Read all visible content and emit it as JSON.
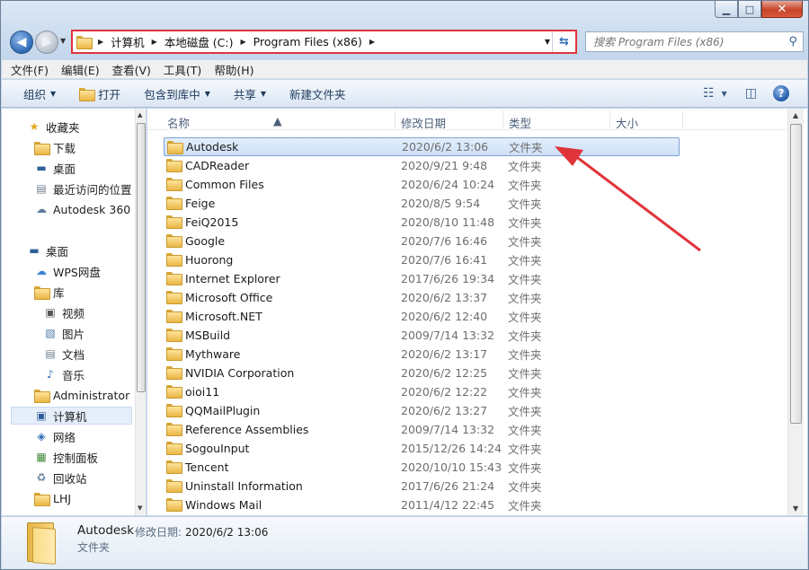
{
  "window": {
    "min_label": "▁",
    "max_label": "□",
    "close_label": "✕"
  },
  "address": {
    "crumbs": [
      "计算机",
      "本地磁盘 (C:)",
      "Program Files (x86)"
    ]
  },
  "search": {
    "placeholder": "搜索 Program Files (x86)"
  },
  "menu": [
    "文件(F)",
    "编辑(E)",
    "查看(V)",
    "工具(T)",
    "帮助(H)"
  ],
  "toolbar": {
    "organize": "组织",
    "open": "打开",
    "include": "包含到库中",
    "share": "共享",
    "new_folder": "新建文件夹"
  },
  "nav": {
    "favorites": "收藏夹",
    "downloads": "下载",
    "desktop_fav": "桌面",
    "recent": "最近访问的位置",
    "autodesk360": "Autodesk 360",
    "desktop": "桌面",
    "wps": "WPS网盘",
    "libraries": "库",
    "videos": "视频",
    "pictures": "图片",
    "documents": "文档",
    "music": "音乐",
    "admin": "Administrator",
    "computer": "计算机",
    "network": "网络",
    "control_panel": "控制面板",
    "recycle": "回收站",
    "lhj": "LHJ"
  },
  "columns": {
    "name": "名称",
    "date": "修改日期",
    "type": "类型",
    "size": "大小"
  },
  "files": [
    {
      "name": "Autodesk",
      "date": "2020/6/2 13:06",
      "type": "文件夹"
    },
    {
      "name": "CADReader",
      "date": "2020/9/21 9:48",
      "type": "文件夹"
    },
    {
      "name": "Common Files",
      "date": "2020/6/24 10:24",
      "type": "文件夹"
    },
    {
      "name": "Feige",
      "date": "2020/8/5 9:54",
      "type": "文件夹"
    },
    {
      "name": "FeiQ2015",
      "date": "2020/8/10 11:48",
      "type": "文件夹"
    },
    {
      "name": "Google",
      "date": "2020/7/6 16:46",
      "type": "文件夹"
    },
    {
      "name": "Huorong",
      "date": "2020/7/6 16:41",
      "type": "文件夹"
    },
    {
      "name": "Internet Explorer",
      "date": "2017/6/26 19:34",
      "type": "文件夹"
    },
    {
      "name": "Microsoft Office",
      "date": "2020/6/2 13:37",
      "type": "文件夹"
    },
    {
      "name": "Microsoft.NET",
      "date": "2020/6/2 12:40",
      "type": "文件夹"
    },
    {
      "name": "MSBuild",
      "date": "2009/7/14 13:32",
      "type": "文件夹"
    },
    {
      "name": "Mythware",
      "date": "2020/6/2 13:17",
      "type": "文件夹"
    },
    {
      "name": "NVIDIA Corporation",
      "date": "2020/6/2 12:25",
      "type": "文件夹"
    },
    {
      "name": "oioi11",
      "date": "2020/6/2 12:22",
      "type": "文件夹"
    },
    {
      "name": "QQMailPlugin",
      "date": "2020/6/2 13:27",
      "type": "文件夹"
    },
    {
      "name": "Reference Assemblies",
      "date": "2009/7/14 13:32",
      "type": "文件夹"
    },
    {
      "name": "SogouInput",
      "date": "2015/12/26 14:24",
      "type": "文件夹"
    },
    {
      "name": "Tencent",
      "date": "2020/10/10 15:43",
      "type": "文件夹"
    },
    {
      "name": "Uninstall Information",
      "date": "2017/6/26 21:24",
      "type": "文件夹"
    },
    {
      "name": "Windows Mail",
      "date": "2011/4/12 22:45",
      "type": "文件夹"
    }
  ],
  "details": {
    "name": "Autodesk",
    "date_label": "修改日期:",
    "date": "2020/6/2 13:06",
    "type": "文件夹"
  },
  "colors": {
    "annotation_red": "#e0343a",
    "selection": "#cde0f7"
  }
}
